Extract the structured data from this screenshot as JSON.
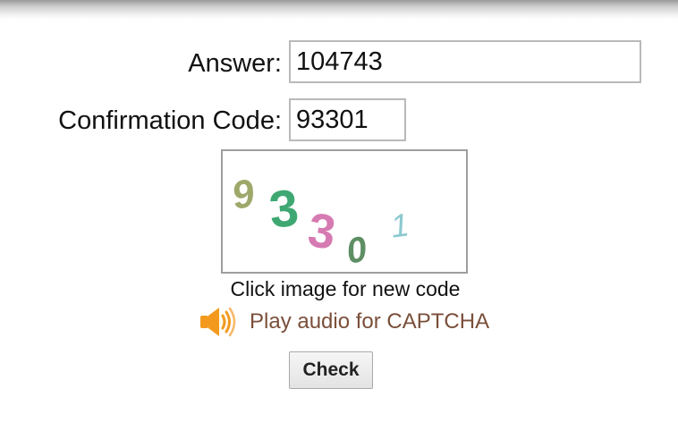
{
  "form": {
    "answer_label": "Answer:",
    "answer_value": "104743",
    "code_label": "Confirmation Code:",
    "code_value": "93301",
    "captcha_image_hint": "Click image for new code",
    "audio_link": "Play audio for CAPTCHA",
    "check_button": "Check"
  },
  "captcha": {
    "glyphs": [
      {
        "char": "9",
        "color": "#9ea86a"
      },
      {
        "char": "3",
        "color": "#3fa872"
      },
      {
        "char": "3",
        "color": "#d67ab2"
      },
      {
        "char": "0",
        "color": "#5e8f64"
      },
      {
        "char": "1",
        "color": "#8cc9cf"
      }
    ]
  },
  "icons": {
    "speaker": "speaker-icon",
    "speaker_color": "#f39a1e"
  }
}
